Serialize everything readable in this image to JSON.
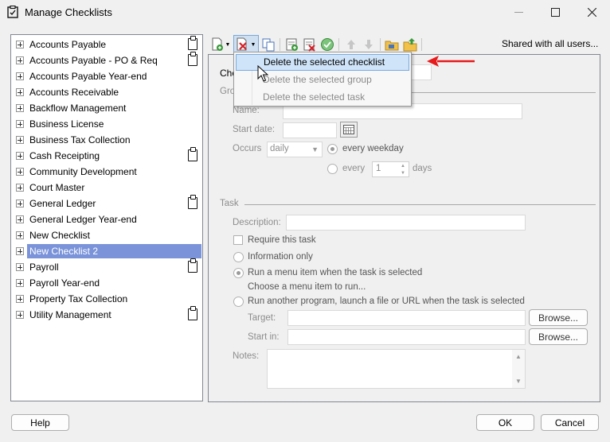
{
  "window": {
    "title": "Manage Checklists"
  },
  "tree": {
    "items": [
      {
        "label": "Accounts Payable",
        "clip": true
      },
      {
        "label": "Accounts Payable - PO & Req",
        "clip": true
      },
      {
        "label": "Accounts Payable Year-end",
        "clip": false
      },
      {
        "label": "Accounts Receivable",
        "clip": false
      },
      {
        "label": "Backflow Management",
        "clip": false
      },
      {
        "label": "Business License",
        "clip": false
      },
      {
        "label": "Business Tax Collection",
        "clip": false
      },
      {
        "label": "Cash Receipting",
        "clip": true
      },
      {
        "label": "Community Development",
        "clip": false
      },
      {
        "label": "Court Master",
        "clip": false
      },
      {
        "label": "General Ledger",
        "clip": true
      },
      {
        "label": "General Ledger Year-end",
        "clip": false
      },
      {
        "label": "New Checklist",
        "clip": false
      },
      {
        "label": "New Checklist 2",
        "clip": false,
        "selected": true
      },
      {
        "label": "Payroll",
        "clip": true
      },
      {
        "label": "Payroll Year-end",
        "clip": false
      },
      {
        "label": "Property Tax Collection",
        "clip": false
      },
      {
        "label": "Utility Management",
        "clip": true
      }
    ]
  },
  "toolbar": {
    "shared_label": "Shared with all users..."
  },
  "menu": {
    "items": [
      "Delete the selected checklist",
      "Delete the selected group",
      "Delete the selected task"
    ]
  },
  "form": {
    "checklist_label_partial": "Che",
    "group_label_partial": "Gro",
    "name_label": "Name:",
    "start_date_label": "Start date:",
    "occurs_label": "Occurs",
    "occurs_value": "daily",
    "every_weekday": "every weekday",
    "every_label": "every",
    "every_value": "1",
    "days_label": "days",
    "task_section": "Task",
    "description_label": "Description:",
    "require_label": "Require this task",
    "info_only": "Information only",
    "run_menu": "Run a menu item when the task is selected",
    "choose_menu": "Choose a menu item to run...",
    "run_program": "Run another program, launch a file or URL when the task is selected",
    "target_label": "Target:",
    "startin_label": "Start in:",
    "browse": "Browse...",
    "notes_label": "Notes:"
  },
  "buttons": {
    "help": "Help",
    "ok": "OK",
    "cancel": "Cancel"
  },
  "colors": {
    "selection": "#7a93d9",
    "menu_highlight": "#cfe4f8",
    "arrow": "#e8191b"
  }
}
